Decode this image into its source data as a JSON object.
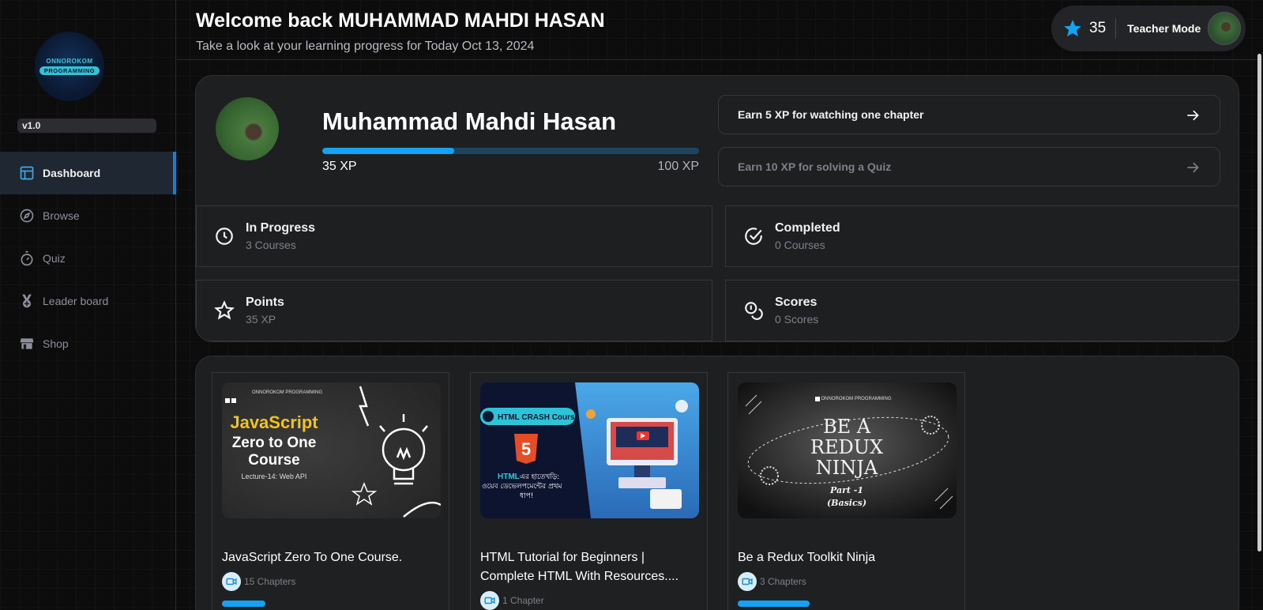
{
  "sidebar": {
    "logo_top": "ONNOROKOM",
    "logo_bottom": "PROGRAMMING",
    "version": "v1.0",
    "items": [
      {
        "label": "Dashboard",
        "icon": "layout-icon",
        "active": true
      },
      {
        "label": "Browse",
        "icon": "compass-icon"
      },
      {
        "label": "Quiz",
        "icon": "timer-icon"
      },
      {
        "label": "Leader board",
        "icon": "medal-icon"
      },
      {
        "label": "Shop",
        "icon": "store-icon"
      }
    ]
  },
  "header": {
    "welcome": "Welcome back MUHAMMAD MAHDI HASAN",
    "subtitle": "Take a look at your learning progress for Today Oct 13, 2024",
    "star_count": "35",
    "teacher_mode": "Teacher Mode"
  },
  "profile": {
    "name": "Muhammad Mahdi Hasan",
    "xp_current": "35 XP",
    "xp_max": "100 XP",
    "xp_progress": 0.35,
    "earn": [
      {
        "label": "Earn 5 XP for watching one chapter"
      },
      {
        "label": "Earn 10 XP for solving a Quiz"
      }
    ],
    "stats": [
      {
        "title": "In Progress",
        "sub": "3 Courses",
        "icon": "clock-icon"
      },
      {
        "title": "Completed",
        "sub": "0 Courses",
        "icon": "check-circle-icon"
      },
      {
        "title": "Points",
        "sub": "35 XP",
        "icon": "star-icon"
      },
      {
        "title": "Scores",
        "sub": "0 Scores",
        "icon": "coins-icon"
      }
    ]
  },
  "courses": [
    {
      "title": "JavaScript Zero To One Course.",
      "chapters": "15 Chapters",
      "progress": 0.2,
      "thumb": {
        "brand": "ONNOROKOM PROGRAMMING",
        "l1": "JavaScript",
        "l2": "Zero to One",
        "l3": "Course",
        "sub": "Lecture-14: Web API"
      }
    },
    {
      "title": "HTML Tutorial for Beginners | Complete HTML With Resources....",
      "chapters": "1 Chapter",
      "progress": 0.0,
      "thumb": {
        "badge": "HTML CRASH Course",
        "l1": "HTML",
        "l2": "এর হাতেখড়ি:",
        "l3": "ওয়েব ডেভেলপমেন্টের প্রথম",
        "l4": "ধাপ!"
      }
    },
    {
      "title": "Be a Redux Toolkit Ninja",
      "chapters": "3 Chapters",
      "progress": 0.33,
      "thumb": {
        "brand": "ONNOROKOM PROGRAMMING",
        "l1": "BE A",
        "l2": "REDUX",
        "l3": "NINJA",
        "l4": "Part -1",
        "l5": "(Basics)"
      }
    }
  ],
  "colors": {
    "accent": "#14a2f5",
    "active_nav": "#1f2733",
    "card": "#1e1f21"
  }
}
